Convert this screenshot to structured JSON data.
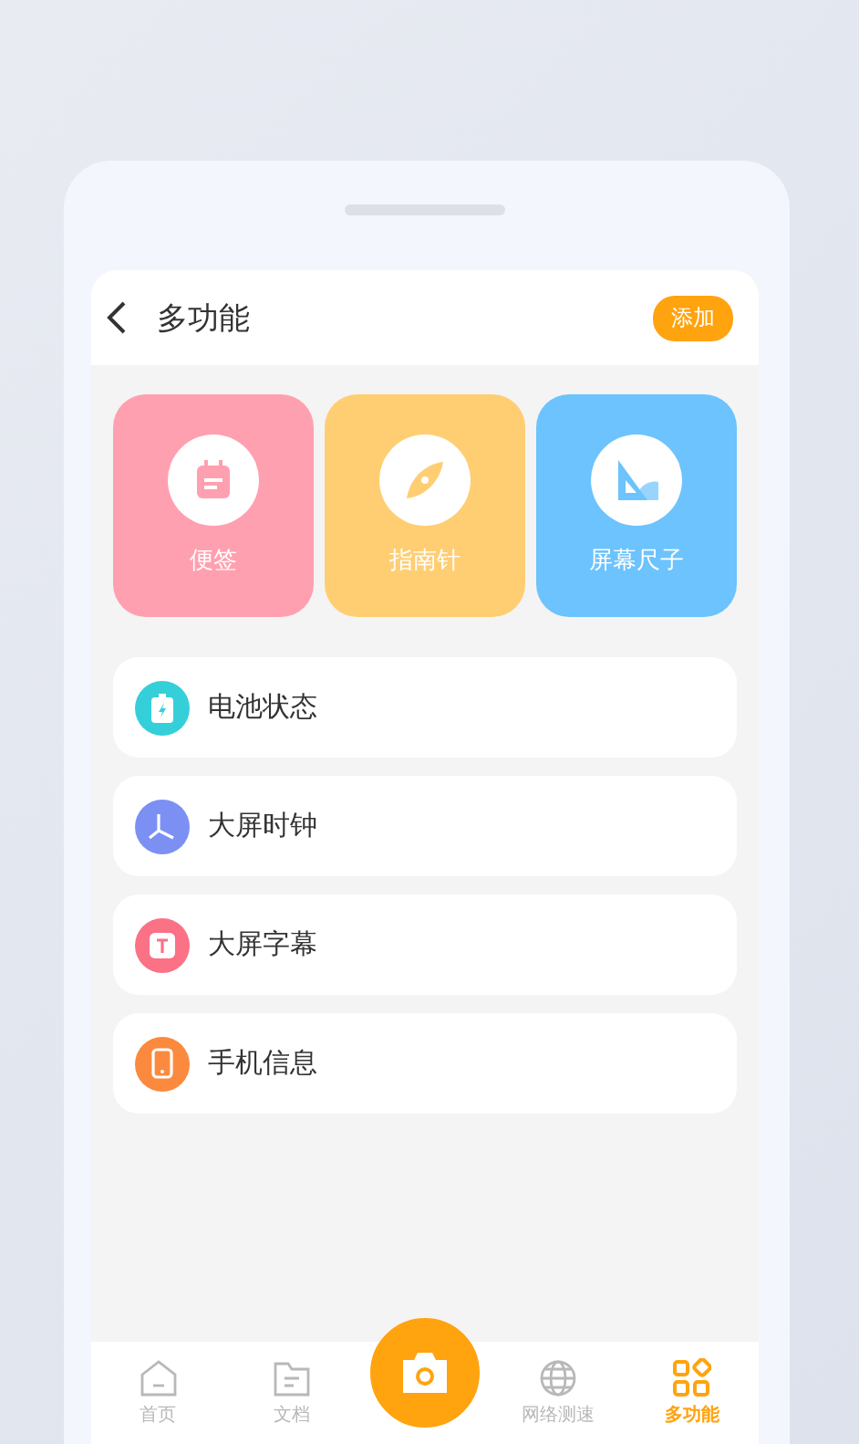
{
  "header": {
    "title": "多功能",
    "action": "添加"
  },
  "tiles": [
    {
      "kind": "note",
      "label": "便签",
      "color": "#ffa0b0"
    },
    {
      "kind": "compass",
      "label": "指南针",
      "color": "#ffce73"
    },
    {
      "kind": "ruler",
      "label": "屏幕尺子",
      "color": "#6cc3fd"
    }
  ],
  "items": [
    {
      "kind": "battery",
      "label": "电池状态",
      "color": "#35cfd9"
    },
    {
      "kind": "clock",
      "label": "大屏时钟",
      "color": "#7c90f4"
    },
    {
      "kind": "caption",
      "label": "大屏字幕",
      "color": "#fb7186"
    },
    {
      "kind": "phone",
      "label": "手机信息",
      "color": "#fb8a3e"
    }
  ],
  "tabs": [
    {
      "kind": "home",
      "label": "首页",
      "selected": false
    },
    {
      "kind": "docs",
      "label": "文档",
      "selected": false
    },
    {
      "kind": "camera",
      "selected": false
    },
    {
      "kind": "network",
      "label": "网络测速",
      "selected": false
    },
    {
      "kind": "tools",
      "label": "多功能",
      "selected": true
    }
  ]
}
